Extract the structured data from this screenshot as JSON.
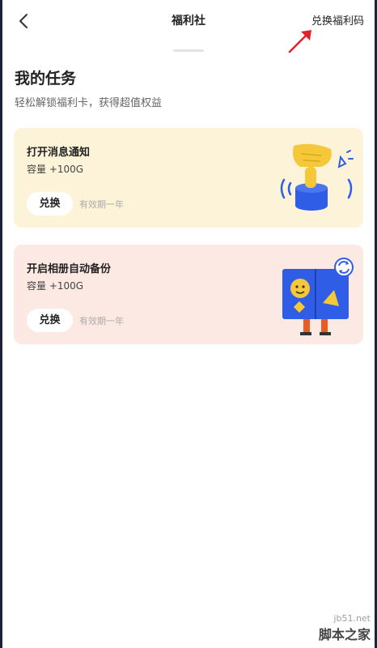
{
  "nav": {
    "title": "福利社",
    "right_link": "兑换福利码",
    "back_icon": "chevron-left-icon"
  },
  "section": {
    "title": "我的任务",
    "subtitle": "轻松解锁福利卡，获得超值权益"
  },
  "tasks": [
    {
      "title": "打开消息通知",
      "capacity": "容量 +100G",
      "button": "兑换",
      "validity": "有效期一年",
      "background": "#fdf3d8",
      "illustration": "notification-bell-icon"
    },
    {
      "title": "开启相册自动备份",
      "capacity": "容量 +100G",
      "button": "兑换",
      "validity": "有效期一年",
      "background": "#fde9e3",
      "illustration": "photo-album-backup-icon"
    }
  ],
  "watermark": {
    "url": "jb51.net",
    "site": "脚本之家"
  },
  "colors": {
    "arrow": "#e5202a",
    "illustration_blue": "#2f5de6",
    "illustration_yellow": "#f5c83a"
  }
}
